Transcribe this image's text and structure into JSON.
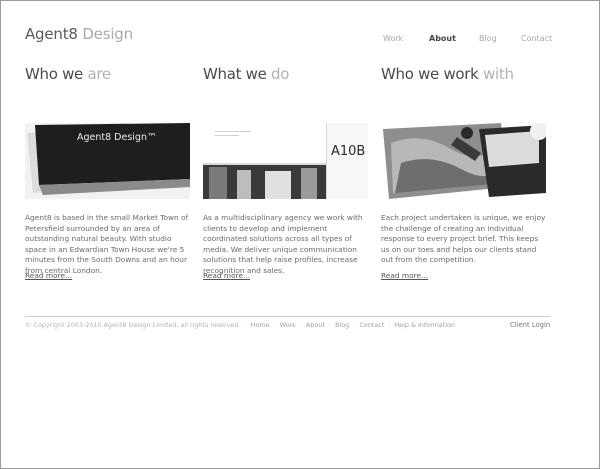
{
  "brand": {
    "word1": "Agent8",
    "word2": "Design"
  },
  "nav": [
    {
      "label": "Work",
      "active": false
    },
    {
      "label": "About",
      "active": true
    },
    {
      "label": "Blog",
      "active": false
    },
    {
      "label": "Contact",
      "active": false
    }
  ],
  "columns": [
    {
      "heading_a": "Who we",
      "heading_b": "are",
      "text": "Agent8 is based in the small Market Town of Petersfield surrounded by an area of outstanding natural beauty. With studio space in an Edwardian Town House we're 5 minutes from the South Downs and an hour from central London.",
      "link": "Read more...",
      "card_text": "Agent8 Design™"
    },
    {
      "heading_a": "What we",
      "heading_b": "do",
      "text": "As a multidisciplinary agency we work with clients to develop and implement coordinated solutions across all types of media. We deliver unique communication solutions that help raise profiles, increase recognition and sales.",
      "link": "Read more...",
      "card_text": "A10B"
    },
    {
      "heading_a": "Who we work",
      "heading_b": "with",
      "text": "Each project undertaken is unique, we enjoy the challenge of creating an individual response to every project brief. This keeps us on our toes and helps our clients stand out from the competition.",
      "link": "Read more...",
      "card_text": ""
    }
  ],
  "footer": {
    "copyright": "© Copyright 2003-2010 Agent8 Design Limited, all rights reserved.",
    "links": [
      "Home",
      "Work",
      "About",
      "Blog",
      "Contact",
      "Help & Information"
    ],
    "client_login": "Client Login"
  },
  "colors": {
    "text_dark": "#4a4a4a",
    "text_light": "#b2b2b2",
    "footer_text": "#a8a8a8"
  }
}
